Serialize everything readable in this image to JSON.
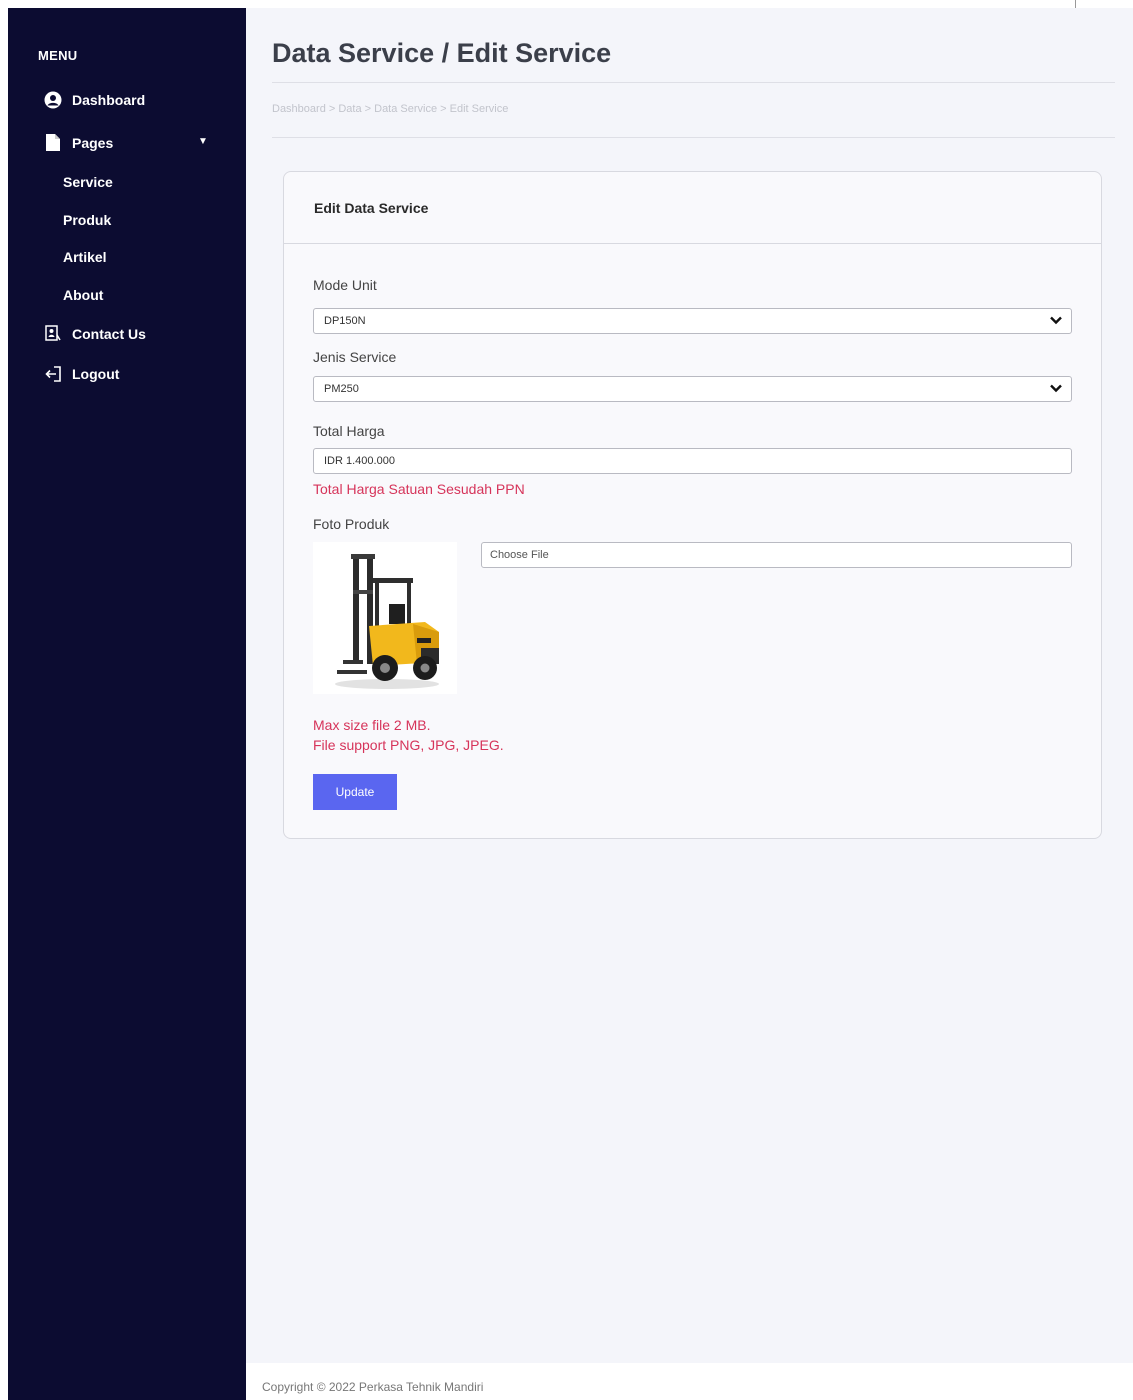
{
  "sidebar": {
    "menu_title": "MENU",
    "items": [
      {
        "label": "Dashboard",
        "icon": "user-circle-icon"
      },
      {
        "label": "Pages",
        "icon": "file-icon"
      },
      {
        "label": "Contact Us",
        "icon": "contact-icon"
      },
      {
        "label": "Logout",
        "icon": "logout-icon"
      }
    ],
    "subitems": [
      "Service",
      "Produk",
      "Artikel",
      "About"
    ]
  },
  "header": {
    "title": "Data Service / Edit Service",
    "breadcrumb": "Dashboard > Data > Data Service > Edit Service"
  },
  "form": {
    "card_title": "Edit Data Service",
    "mode_unit_label": "Mode Unit",
    "mode_unit_value": "DP150N",
    "jenis_service_label": "Jenis Service",
    "jenis_service_value": "PM250",
    "total_harga_label": "Total Harga",
    "total_harga_value": "IDR 1.400.000",
    "total_harga_hint": "Total Harga Satuan Sesudah PPN",
    "foto_label": "Foto Produk",
    "file_button": "Choose File",
    "max_size_hint": "Max size file 2 MB.",
    "file_support_hint": "File support PNG, JPG, JPEG.",
    "update_label": "Update"
  },
  "footer": {
    "copyright": "Copyright © 2022 Perkasa Tehnik Mandiri"
  },
  "colors": {
    "sidebar_bg": "#0c0c31",
    "accent": "#5a66f0",
    "hint": "#d6345a"
  }
}
